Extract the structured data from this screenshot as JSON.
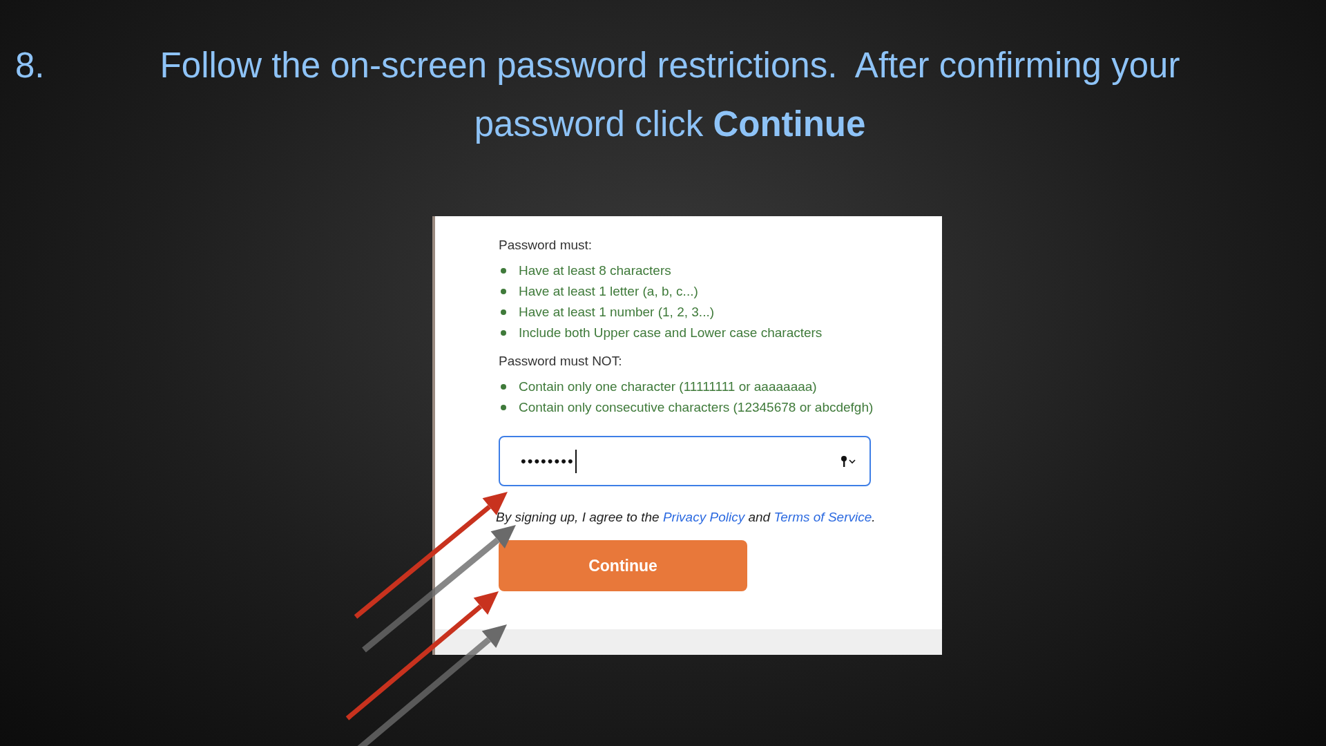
{
  "slide": {
    "step_number": "8.",
    "instruction": "Follow the on-screen password restrictions.  After confirming your password click **Continue**"
  },
  "form": {
    "requirements_heading": "Password must:",
    "requirements": [
      "Have at least 8 characters",
      "Have at least 1 letter (a, b, c...)",
      "Have at least 1 number (1, 2, 3...)",
      "Include both Upper case and Lower case characters"
    ],
    "prohibitions_heading": "Password must NOT:",
    "prohibitions": [
      "Contain only one character (11111111 or aaaaaaaa)",
      "Contain only consecutive characters (12345678 or abcdefgh)"
    ],
    "password_field": {
      "value": "••••••••",
      "focused": true
    },
    "agreement": {
      "prefix": "By signing up, I agree to the ",
      "privacy_link": "Privacy Policy",
      "middle": " and ",
      "terms_link": "Terms of Service",
      "suffix": "."
    },
    "continue_button": "Continue"
  }
}
